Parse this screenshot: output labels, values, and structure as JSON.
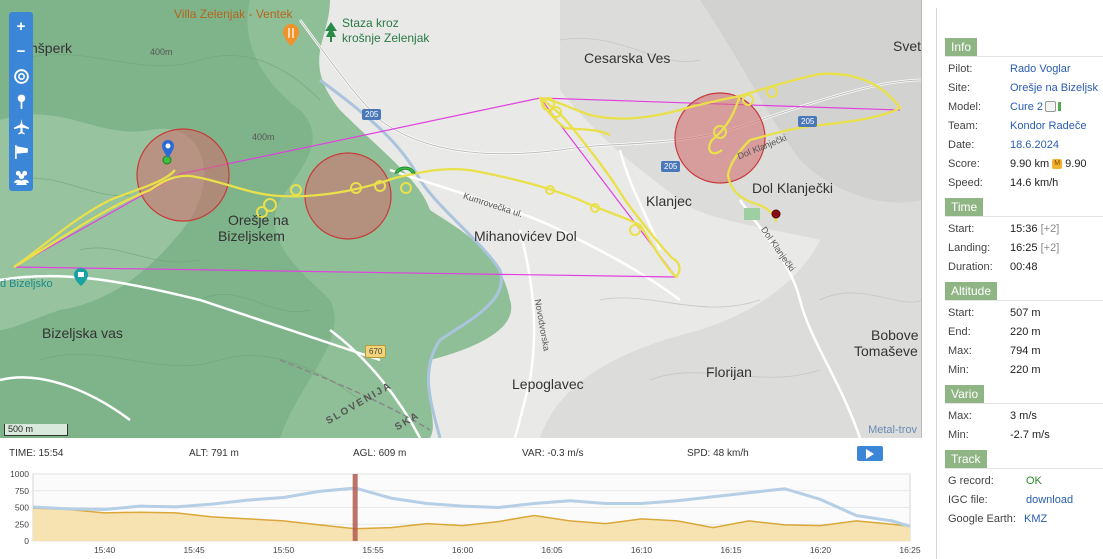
{
  "map": {
    "labels": {
      "villa": "Villa Zelenjak - Ventek",
      "staza_1": "Staza kroz",
      "staza_2": "krošnje Zelenjak",
      "insperk": "nšperk",
      "cesarska_ves": "Cesarska Ves",
      "svet": "Svet",
      "oresje_1": "Orešje na",
      "oresje_2": "Bizeljskem",
      "mihanovicev_dol": "Mihanovićev Dol",
      "klanjec": "Klanjec",
      "dol_klanjecki": "Dol Klanječki",
      "bizeljsko": "d Bizeljsko",
      "bizeljska_vas": "Bizeljska vas",
      "lepoglavec": "Lepoglavec",
      "florijan": "Florijan",
      "bobove_1": "Bobove",
      "bobove_2": "Tomaševe",
      "slovenija": "SLOVENIJA",
      "ska": "SKA",
      "kumroveca": "Kumrovečka ul.",
      "novodvorska": "Novodvorska",
      "dol_klanjecki_road": "Dol Klanječki",
      "dol_klanjecki_road2": "Dol Klanječki",
      "contour_400a": "400m",
      "contour_400b": "400m",
      "road_205a": "205",
      "road_205b": "205",
      "road_205c": "205",
      "road_670": "670"
    },
    "scale_label": "500 m",
    "attribution": "Metal-trov"
  },
  "toolbar": {
    "zoom_in": "+",
    "zoom_out": "−"
  },
  "stats": {
    "time_label": "TIME:",
    "time_value": "15:54",
    "alt_label": "ALT:",
    "alt_value": "791 m",
    "agl_label": "AGL:",
    "agl_value": "609 m",
    "var_label": "VAR:",
    "var_value": "-0.3 m/s",
    "spd_label": "SPD:",
    "spd_value": "48 km/h"
  },
  "chart_data": {
    "type": "area",
    "x_ticks": [
      "15:40",
      "15:45",
      "15:50",
      "15:55",
      "16:00",
      "16:05",
      "16:10",
      "16:15",
      "16:20",
      "16:25"
    ],
    "y_ticks": [
      0,
      250,
      500,
      750,
      1000
    ],
    "ylim": [
      0,
      1000
    ],
    "x_range": [
      "15:36",
      "16:25"
    ],
    "cursor_time": "15:54",
    "series": [
      {
        "role": "altitude",
        "color": "#b5cfe6",
        "x": [
          "15:36",
          "15:38",
          "15:40",
          "15:42",
          "15:44",
          "15:46",
          "15:48",
          "15:50",
          "15:52",
          "15:54",
          "15:56",
          "15:58",
          "16:00",
          "16:02",
          "16:04",
          "16:06",
          "16:08",
          "16:10",
          "16:12",
          "16:14",
          "16:16",
          "16:18",
          "16:20",
          "16:22",
          "16:24",
          "16:25"
        ],
        "values": [
          507,
          480,
          470,
          520,
          510,
          550,
          610,
          650,
          740,
          791,
          640,
          560,
          520,
          500,
          560,
          600,
          560,
          560,
          600,
          660,
          720,
          780,
          620,
          380,
          300,
          220
        ]
      },
      {
        "role": "ground",
        "color": "#f1cd7e",
        "x": [
          "15:36",
          "15:38",
          "15:40",
          "15:42",
          "15:44",
          "15:46",
          "15:48",
          "15:50",
          "15:52",
          "15:54",
          "15:56",
          "15:58",
          "16:00",
          "16:02",
          "16:04",
          "16:06",
          "16:08",
          "16:10",
          "16:12",
          "16:14",
          "16:16",
          "16:18",
          "16:20",
          "16:22",
          "16:24",
          "16:25"
        ],
        "values": [
          490,
          470,
          420,
          430,
          420,
          360,
          330,
          300,
          240,
          182,
          200,
          260,
          230,
          290,
          380,
          300,
          260,
          330,
          300,
          200,
          300,
          240,
          230,
          300,
          250,
          220
        ]
      }
    ]
  },
  "panel": {
    "info": {
      "title": "Info",
      "pilot_k": "Pilot:",
      "pilot_v": "Rado Voglar",
      "site_k": "Site:",
      "site_v": "Orešje na Bizeljsk",
      "model_k": "Model:",
      "model_v": "Cure 2",
      "team_k": "Team:",
      "team_v": "Kondor Radeče",
      "date_k": "Date:",
      "date_v": "18.6.2024",
      "score_k": "Score:",
      "score_v": "9.90 km",
      "score_v2": "9.90",
      "speed_k": "Speed:",
      "speed_v": "14.6 km/h"
    },
    "time": {
      "title": "Time",
      "start_k": "Start:",
      "start_v": "15:36",
      "start_tz": "[+2]",
      "landing_k": "Landing:",
      "landing_v": "16:25",
      "landing_tz": "[+2]",
      "duration_k": "Duration:",
      "duration_v": "00:48"
    },
    "altitude": {
      "title": "Altitude",
      "start_k": "Start:",
      "start_v": "507 m",
      "end_k": "End:",
      "end_v": "220 m",
      "max_k": "Max:",
      "max_v": "794 m",
      "min_k": "Min:",
      "min_v": "220 m"
    },
    "vario": {
      "title": "Vario",
      "max_k": "Max:",
      "max_v": "3 m/s",
      "min_k": "Min:",
      "min_v": "-2.7 m/s"
    },
    "track": {
      "title": "Track",
      "grecord_k": "G record:",
      "grecord_v": "OK",
      "igc_k": "IGC file:",
      "igc_v": "download",
      "ge_k": "Google Earth:",
      "ge_v": "KMZ"
    }
  }
}
